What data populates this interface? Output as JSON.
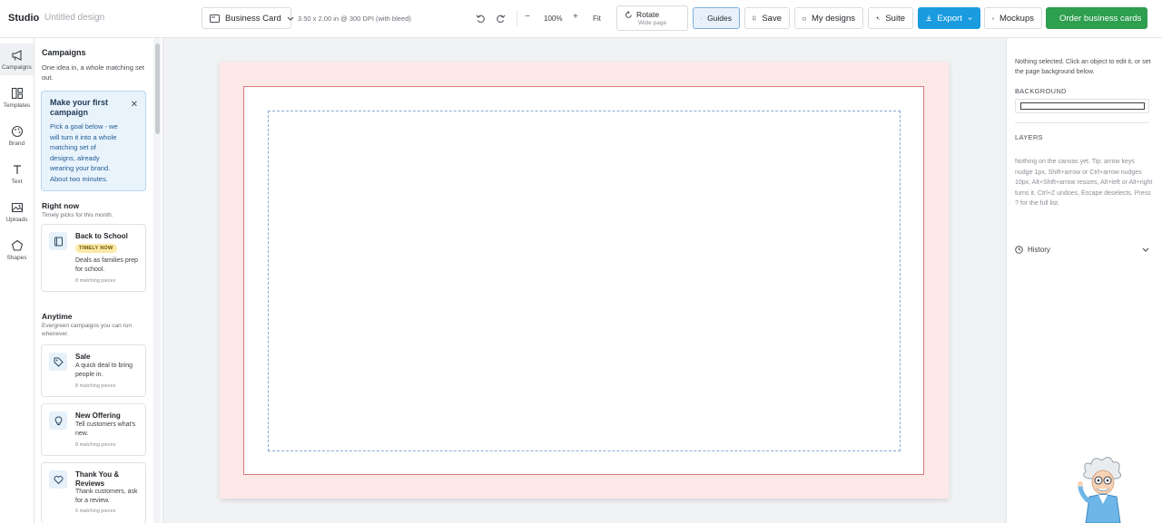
{
  "app": {
    "name": "Studio",
    "document_name": "Untitled design"
  },
  "toolbar": {
    "format_label": "Business Card",
    "dimensions": "3.50 x 2.00 in @ 300 DPI (with bleed)",
    "zoom_minus": "−",
    "zoom_value": "100%",
    "zoom_plus": "+",
    "fit_label": "Fit",
    "rotate_label": "Rotate",
    "rotate_sub": "Wide page",
    "guides_label": "Guides",
    "save_label": "Save",
    "my_designs_label": "My designs",
    "suite_label": "Suite",
    "export_label": "Export",
    "mockups_label": "Mockups",
    "order_label": "Order business cards",
    "export_color": "#1a9be0",
    "order_color": "#2e9e4f"
  },
  "rail": [
    {
      "label": "Campaigns",
      "icon": "megaphone-icon"
    },
    {
      "label": "Templates",
      "icon": "layout-icon"
    },
    {
      "label": "Brand",
      "icon": "palette-icon"
    },
    {
      "label": "Text",
      "icon": "text-icon"
    },
    {
      "label": "Uploads",
      "icon": "image-icon"
    },
    {
      "label": "Shapes",
      "icon": "pentagon-icon"
    }
  ],
  "panel": {
    "title": "Campaigns",
    "subtitle": "One idea in, a whole matching set out.",
    "promo": {
      "title": "Make your first campaign",
      "body": "Pick a goal below - we will turn it into a whole matching set of designs, already wearing your brand. About two minutes."
    },
    "right_now": {
      "title": "Right now",
      "subtitle": "Timely picks for this month.",
      "cards": [
        {
          "title": "Back to School",
          "badge": "TIMELY NOW",
          "body": "Deals as families prep for school.",
          "count": "8 matching pieces",
          "icon": "book-icon"
        }
      ]
    },
    "anytime": {
      "title": "Anytime",
      "subtitle": "Evergreen campaigns you can run whenever.",
      "cards": [
        {
          "title": "Sale",
          "body": "A quick deal to bring people in.",
          "count": "8 matching pieces",
          "icon": "tag-icon"
        },
        {
          "title": "New Offering",
          "body": "Tell customers what's new.",
          "count": "8 matching pieces",
          "icon": "lightbulb-icon"
        },
        {
          "title": "Thank You & Reviews",
          "body": "Thank customers, ask for a review.",
          "count": "6 matching pieces",
          "icon": "heart-icon"
        }
      ]
    }
  },
  "right_panel": {
    "note": "Nothing selected. Click an object to edit it, or set the page background below.",
    "background_label": "BACKGROUND",
    "layers_label": "LAYERS",
    "tip": "Nothing on the canvas yet. Tip: arrow keys nudge 1px, Shift+arrow or Ctrl+arrow nudges 10px, Alt+Shift+arrow resizes, Alt+left or Alt+right turns it. Ctrl+Z undoes, Escape deselects. Press ? for the full list.",
    "history_label": "History"
  },
  "canvas": {
    "bleed_color": "#fde8e8",
    "trim_color": "#d97a7a",
    "safe_color": "#8aa9d4"
  }
}
